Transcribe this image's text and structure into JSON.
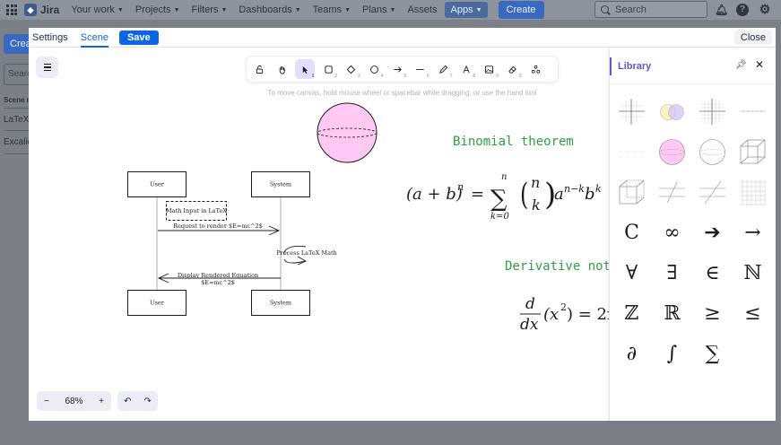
{
  "topnav": {
    "brand": "Jira",
    "items": [
      "Your work",
      "Projects",
      "Filters",
      "Dashboards",
      "Teams",
      "Plans"
    ],
    "assets": "Assets",
    "apps": "Apps",
    "create": "Create",
    "search_placeholder": "Search"
  },
  "background": {
    "create": "Create",
    "search": "Search",
    "header": "Scene name",
    "row1": "LaTeX Demo",
    "row2": "Excalidraw"
  },
  "modal": {
    "tabs": [
      "Settings",
      "Scene"
    ],
    "active_tab": "Scene",
    "save": "Save",
    "close": "Close"
  },
  "toolbar": {
    "tools": [
      {
        "name": "lock-icon",
        "num": ""
      },
      {
        "name": "hand-icon",
        "num": ""
      },
      {
        "name": "selection-icon",
        "num": "1"
      },
      {
        "name": "rectangle-icon",
        "num": "2"
      },
      {
        "name": "diamond-icon",
        "num": "3"
      },
      {
        "name": "ellipse-icon",
        "num": "4"
      },
      {
        "name": "arrow-icon",
        "num": "5"
      },
      {
        "name": "line-icon",
        "num": "6"
      },
      {
        "name": "draw-icon",
        "num": "7"
      },
      {
        "name": "text-icon",
        "num": "8"
      },
      {
        "name": "image-icon",
        "num": "9"
      },
      {
        "name": "eraser-icon",
        "num": "0"
      },
      {
        "name": "more-tools-icon",
        "num": ""
      }
    ]
  },
  "canvas": {
    "hint": "To move canvas, hold mouse wheel or spacebar while dragging, or use the hand tool",
    "diagram": {
      "user_top": "User",
      "system_top": "System",
      "user_bottom": "User",
      "system_bottom": "System",
      "note": "Math Input in LaTeX",
      "request": "Request to render $E=mc^2$",
      "process": "Process LaTeX Math",
      "display_line1": "Display Rendered Equation",
      "display_line2": "$E=mc^2$"
    },
    "binomial_title": "Binomial theorem",
    "derivative_title": "Derivative nota"
  },
  "zoom": {
    "minus": "−",
    "level": "68%",
    "plus": "+"
  },
  "library": {
    "title": "Library",
    "symbols": [
      "C",
      "∞",
      "➔",
      "→",
      "∀",
      "∃",
      "∈",
      "ℕ",
      "ℤ",
      "ℝ",
      "≥",
      "≤",
      "∂",
      "∫",
      "∑"
    ]
  },
  "colors": {
    "accent": "#5b57d1",
    "jira_blue": "#0c66e4",
    "green_text": "#2f9e44",
    "sphere_fill": "#ffc9f4"
  }
}
